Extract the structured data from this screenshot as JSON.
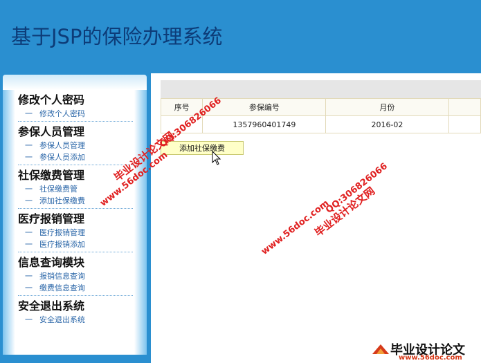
{
  "app": {
    "title": "基于JSP的保险办理系统"
  },
  "sidebar": {
    "groups": [
      {
        "title": "修改个人密码",
        "items": [
          "修改个人密码"
        ]
      },
      {
        "title": "参保人员管理",
        "items": [
          "参保人员管理",
          "参保人员添加"
        ]
      },
      {
        "title": "社保缴费管理",
        "items": [
          "社保缴费管",
          "添加社保缴费"
        ]
      },
      {
        "title": "医疗报销管理",
        "items": [
          "医疗报销管理",
          "医疗报销添加"
        ]
      },
      {
        "title": "信息查询模块",
        "items": [
          "报销信息查询",
          "缴费信息查询"
        ]
      },
      {
        "title": "安全退出系统",
        "items": [
          "安全退出系统"
        ]
      }
    ],
    "dash": "一"
  },
  "table": {
    "headers": [
      "序号",
      "参保编号",
      "月份",
      ""
    ],
    "rows": [
      [
        "",
        "1357960401749",
        "2016-02",
        ""
      ]
    ]
  },
  "actions": {
    "add_label": "添加社保缴费"
  },
  "watermarks": {
    "site_a": "毕业设计论文网",
    "qq_a": "QQ:306826066",
    "url_a": "www.56doc.com",
    "qq_b": "QQ:306826066",
    "url_b": "www.56doc.com",
    "site_b": "毕业设计论文网",
    "logo_text": "毕业设计论文",
    "logo_url": "www.56doc.com"
  },
  "colors": {
    "header_bg": "#2a8fd0",
    "title": "#0d3c78",
    "watermark": "#e02020"
  }
}
